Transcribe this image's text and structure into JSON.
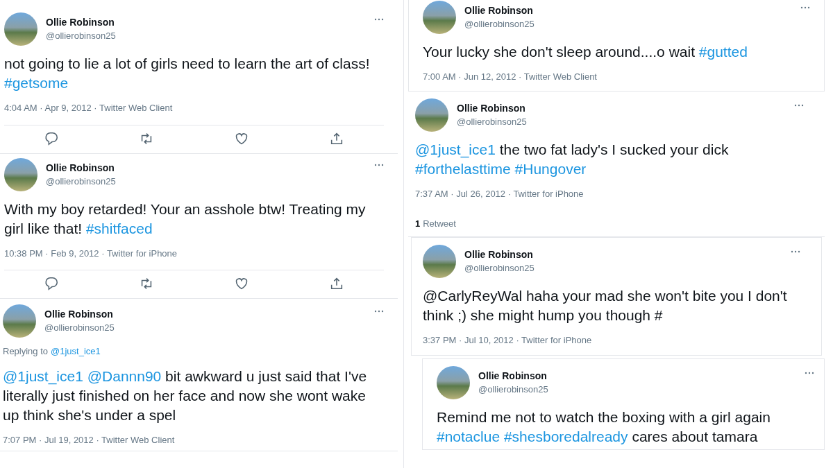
{
  "columns": [
    {
      "tweets": [
        {
          "name": "Ollie Robinson",
          "handle": "@ollierobinson25",
          "text": [
            {
              "kind": "plain",
              "text": "not going to lie a lot of girls need to learn the art of class! "
            },
            {
              "kind": "link",
              "text": "#getsome"
            }
          ],
          "meta": "4:04 AM · Apr 9, 2012 · Twitter Web Client",
          "actions": true
        },
        {
          "name": "Ollie Robinson",
          "handle": "@ollierobinson25",
          "text": [
            {
              "kind": "plain",
              "text": "With my boy retarded! Your an asshole btw! Treating my girl like that! "
            },
            {
              "kind": "link",
              "text": "#shitfaced"
            }
          ],
          "meta": "10:38 PM · Feb 9, 2012 · Twitter for iPhone",
          "actions": true
        },
        {
          "name": "Ollie Robinson",
          "handle": "@ollierobinson25",
          "replying_to": {
            "label": "Replying to",
            "handle": "@1just_ice1"
          },
          "text": [
            {
              "kind": "link",
              "text": "@1just_ice1 "
            },
            {
              "kind": "link",
              "text": "@Dannn90"
            },
            {
              "kind": "plain",
              "text": " bit awkward u just said that I've literally just finished on her face and now she wont wake up think she's under a spel"
            }
          ],
          "meta": "7:07 PM · Jul 19, 2012 · Twitter Web Client",
          "actions": false
        }
      ]
    },
    {
      "tweets": [
        {
          "name": "Ollie Robinson",
          "handle": "@ollierobinson25",
          "text": [
            {
              "kind": "plain",
              "text": "Your lucky she don't sleep around....o wait "
            },
            {
              "kind": "link",
              "text": "#gutted"
            }
          ],
          "meta": "7:00 AM · Jun 12, 2012 · Twitter Web Client",
          "actions": false
        },
        {
          "name": "Ollie Robinson",
          "handle": "@ollierobinson25",
          "text": [
            {
              "kind": "link",
              "text": "@1just_ice1"
            },
            {
              "kind": "plain",
              "text": " the two fat lady's I sucked your dick "
            },
            {
              "kind": "link",
              "text": "#forthelasttime "
            },
            {
              "kind": "link",
              "text": "#Hungover"
            }
          ],
          "meta": "7:37 AM · Jul 26, 2012 · Twitter for iPhone",
          "retweets": {
            "count": "1",
            "label": "Retweet"
          },
          "actions": false
        },
        {
          "name": "Ollie Robinson",
          "handle": "@ollierobinson25",
          "text": [
            {
              "kind": "plain",
              "text": "@CarlyReyWal haha your mad she won't bite you I don't think ;) she might hump you though #"
            }
          ],
          "meta": "3:37 PM · Jul 10, 2012 · Twitter for iPhone",
          "actions": false
        },
        {
          "name": "Ollie Robinson",
          "handle": "@ollierobinson25",
          "text": [
            {
              "kind": "plain",
              "text": "Remind me not to watch the boxing with a girl again "
            },
            {
              "kind": "link",
              "text": "#notaclue "
            },
            {
              "kind": "link",
              "text": "#shesboredalready"
            },
            {
              "kind": "plain",
              "text": " cares about tamara"
            }
          ],
          "actions": false
        }
      ]
    }
  ]
}
